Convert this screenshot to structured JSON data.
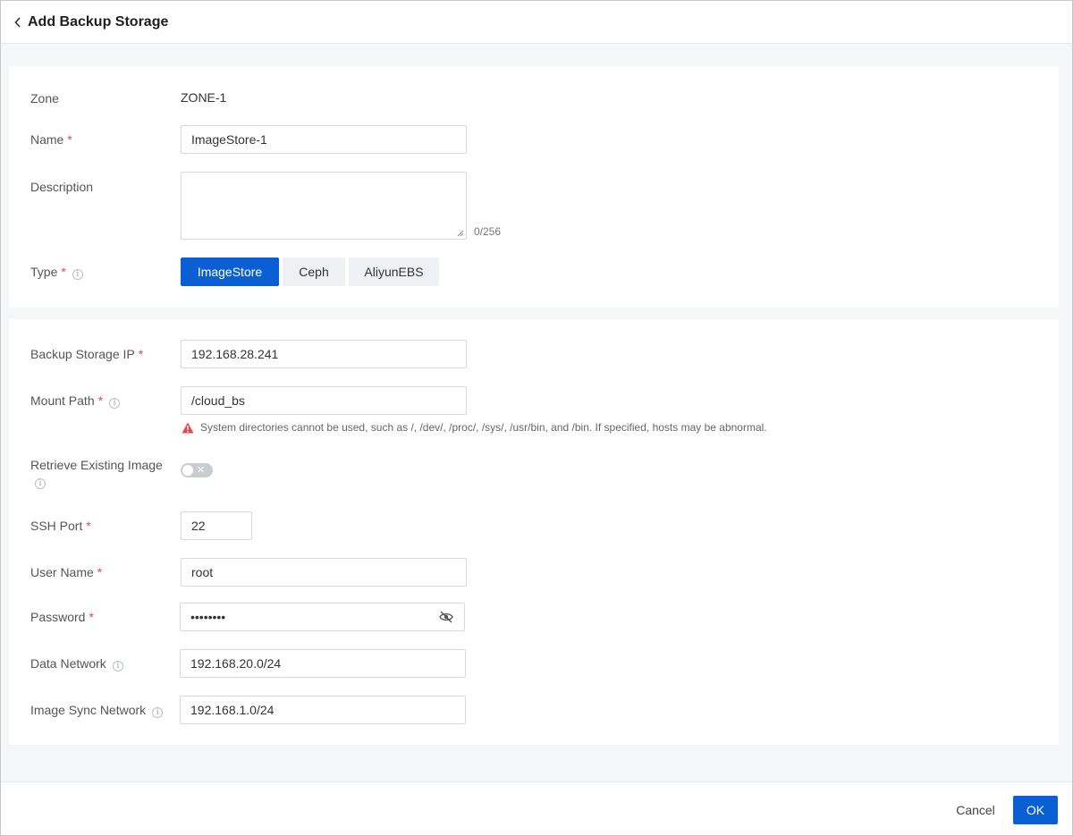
{
  "header": {
    "title": "Add Backup Storage"
  },
  "basic": {
    "zone": {
      "label": "Zone",
      "value": "ZONE-1"
    },
    "name": {
      "label": "Name",
      "required": "*",
      "value": "ImageStore-1"
    },
    "description": {
      "label": "Description",
      "value": "",
      "counter": "0/256"
    },
    "type": {
      "label": "Type",
      "required": "*",
      "options": [
        "ImageStore",
        "Ceph",
        "AliyunEBS"
      ],
      "selected": "ImageStore"
    }
  },
  "config": {
    "backup_ip": {
      "label": "Backup Storage IP",
      "required": "*",
      "value": "192.168.28.241"
    },
    "mount_path": {
      "label": "Mount Path",
      "required": "*",
      "value": "/cloud_bs",
      "warning": "System directories cannot be used, such as /, /dev/, /proc/, /sys/, /usr/bin, and /bin. If specified, hosts may be abnormal."
    },
    "retrieve_image": {
      "label": "Retrieve Existing Image",
      "enabled": false
    },
    "ssh_port": {
      "label": "SSH Port",
      "required": "*",
      "value": "22"
    },
    "user_name": {
      "label": "User Name",
      "required": "*",
      "value": "root"
    },
    "password": {
      "label": "Password",
      "required": "*",
      "value": "••••••••"
    },
    "data_network": {
      "label": "Data Network",
      "value": "192.168.20.0/24"
    },
    "image_sync_network": {
      "label": "Image Sync Network",
      "value": "192.168.1.0/24"
    }
  },
  "footer": {
    "cancel_label": "Cancel",
    "ok_label": "OK"
  },
  "colors": {
    "primary": "#0a5fd4",
    "required": "#e5484d",
    "warning": "#e5484d"
  },
  "icons": [
    "back-chevron-icon",
    "info-icon",
    "warning-icon",
    "eye-off-icon",
    "toggle-x-icon"
  ]
}
